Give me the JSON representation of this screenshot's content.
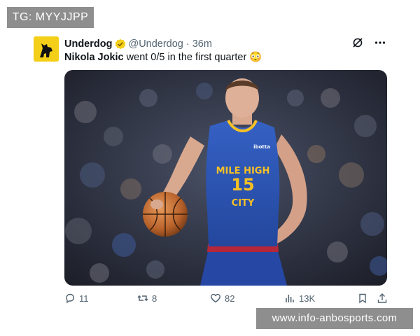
{
  "watermarks": {
    "top": "TG: MYYJJPP",
    "bottom": "www.info-anbosports.com"
  },
  "tweet": {
    "display_name": "Underdog",
    "handle": "@Underdog",
    "separator": "·",
    "time": "36m",
    "text_mention": "Nikola Jokic",
    "text_rest": " went 0/5 in the first quarter",
    "emoji": "😳",
    "media_jersey": {
      "line1": "MILE HIGH",
      "number": "15",
      "line2": "CITY",
      "sponsor": "ibotta"
    }
  },
  "actions": {
    "replies": "11",
    "retweets": "8",
    "likes": "82",
    "views": "13K"
  },
  "colors": {
    "verified": "#f4cf19",
    "avatar_bg": "#f4cf19",
    "muted": "#536471",
    "jersey_blue": "#2a4fae",
    "jersey_gold": "#f6c125",
    "jersey_red": "#b4273a"
  }
}
